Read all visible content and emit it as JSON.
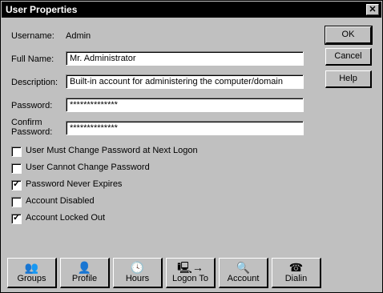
{
  "window": {
    "title": "User Properties",
    "close_glyph": "✕"
  },
  "form": {
    "username_label": "Username:",
    "username_value": "Admin",
    "fullname_label": "Full Name:",
    "fullname_value": "Mr. Administrator",
    "description_label": "Description:",
    "description_value": "Built-in account for administering the computer/domain",
    "password_label": "Password:",
    "password_value": "**************",
    "confirm_label_line1": "Confirm",
    "confirm_label_line2": "Password:",
    "confirm_value": "**************"
  },
  "buttons": {
    "ok": "OK",
    "cancel": "Cancel",
    "help": "Help"
  },
  "options": [
    {
      "label": "User Must Change Password at Next Logon",
      "checked": false
    },
    {
      "label": "User Cannot Change Password",
      "checked": false
    },
    {
      "label": "Password Never Expires",
      "checked": true
    },
    {
      "label": "Account Disabled",
      "checked": false
    },
    {
      "label": "Account Locked Out",
      "checked": true
    }
  ],
  "check_glyph": "✓",
  "toolbar": [
    {
      "label": "Groups",
      "icon": "groups-icon",
      "glyph": "👥"
    },
    {
      "label": "Profile",
      "icon": "profile-icon",
      "glyph": "👤"
    },
    {
      "label": "Hours",
      "icon": "clock-icon",
      "glyph": "🕓"
    },
    {
      "label": "Logon To",
      "icon": "logon-to-icon",
      "glyph": "🖳→"
    },
    {
      "label": "Account",
      "icon": "account-icon",
      "glyph": "🔍"
    },
    {
      "label": "Dialin",
      "icon": "dialin-icon",
      "glyph": "☎"
    }
  ]
}
